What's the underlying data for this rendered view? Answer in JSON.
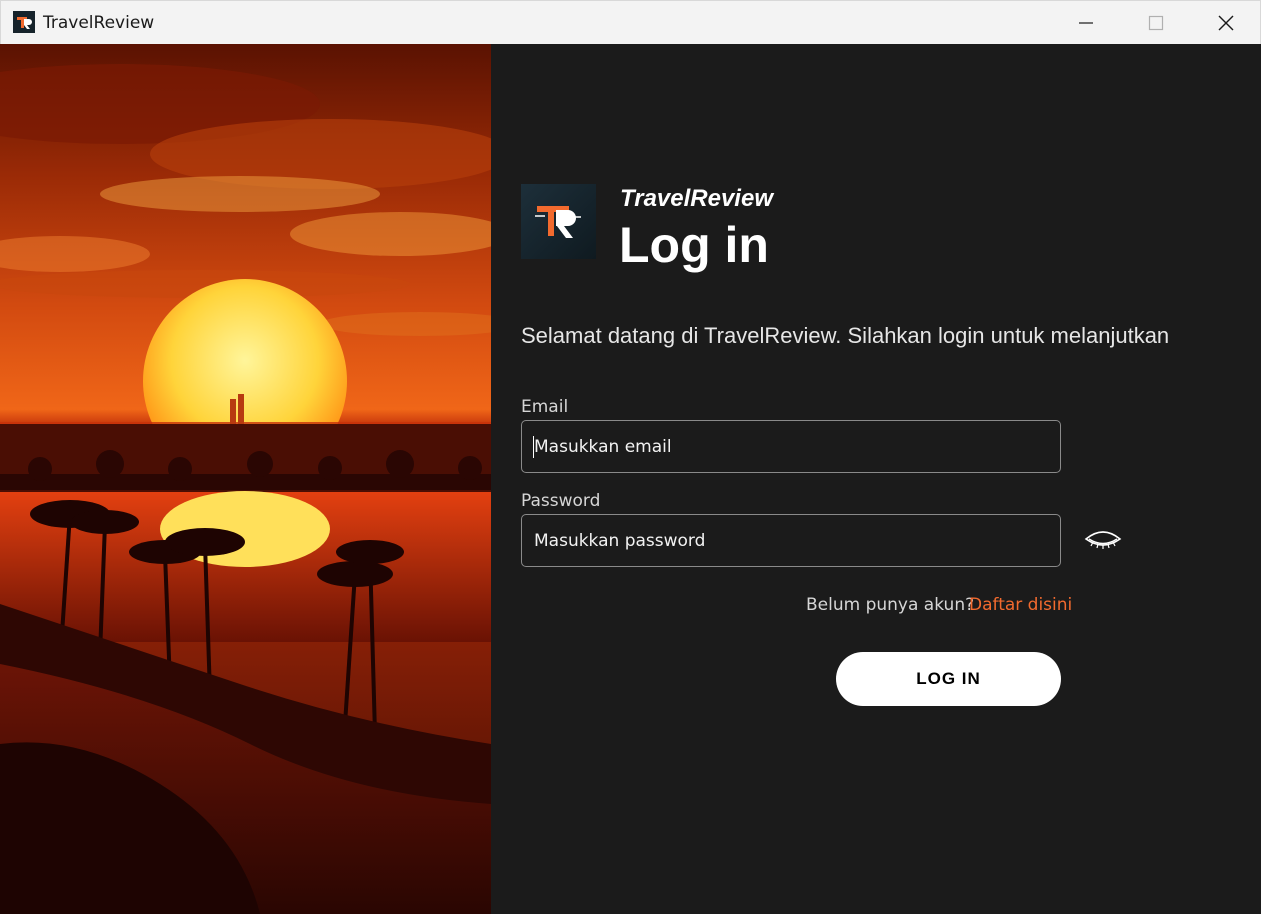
{
  "window": {
    "title": "TravelReview",
    "app_icon": "travelreview-logo-icon",
    "controls": [
      "minimize-icon",
      "maximize-icon",
      "close-icon"
    ]
  },
  "hero_image": {
    "description_icon": "sunset-oasis-photo"
  },
  "login": {
    "brand": "TravelReview",
    "title": "Log in",
    "welcome": "Selamat datang di TravelReview. Silahkan login untuk melanjutkan",
    "email": {
      "label": "Email",
      "placeholder": "Masukkan email",
      "value": ""
    },
    "password": {
      "label": "Password",
      "placeholder": "Masukkan password",
      "value": "",
      "toggle_icon": "eye-closed-icon"
    },
    "signup_prompt": "Belum punya akun?",
    "signup_link": "Daftar disini",
    "submit_label": "LOG IN"
  },
  "colors": {
    "background": "#1b1b1b",
    "accent": "#f26a2e",
    "button_bg": "#ffffff",
    "titlebar_bg": "#f3f3f3"
  }
}
